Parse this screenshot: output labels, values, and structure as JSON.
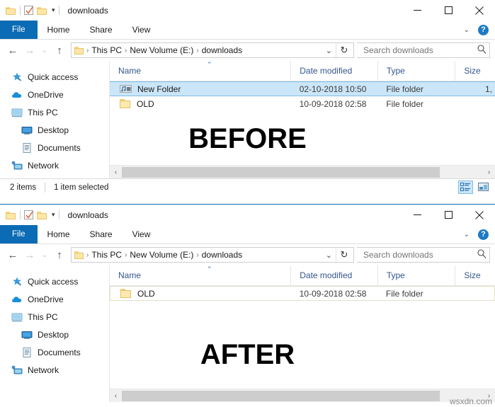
{
  "window": {
    "title": "downloads",
    "qat": {
      "folder_icon": "folder-icon",
      "properties_icon": "properties-checkbox-icon",
      "new_folder_icon": "new-folder-icon",
      "customize_caret": "▾"
    },
    "controls": {
      "minimize": "minimize-icon",
      "maximize": "maximize-icon",
      "close": "close-icon"
    },
    "ribbon": {
      "tabs": [
        "File",
        "Home",
        "Share",
        "View"
      ],
      "collapse_caret": "⌄",
      "help_label": "?"
    },
    "address": {
      "back": "←",
      "forward": "→",
      "recent": "⌄",
      "up": "↑",
      "crumbs": [
        "This PC",
        "New Volume (E:)",
        "downloads"
      ],
      "separator": "›",
      "dropdown_caret": "⌄",
      "refresh": "↻"
    },
    "search": {
      "placeholder": "Search downloads",
      "value": "",
      "icon": "search-icon"
    }
  },
  "navpane": {
    "items": [
      {
        "label": "Quick access",
        "icon": "star-pin-icon",
        "indent": false
      },
      {
        "label": "OneDrive",
        "icon": "cloud-icon",
        "indent": false
      },
      {
        "label": "This PC",
        "icon": "monitor-icon",
        "indent": false
      },
      {
        "label": "Desktop",
        "icon": "desktop-icon",
        "indent": true
      },
      {
        "label": "Documents",
        "icon": "document-icon",
        "indent": true
      },
      {
        "label": "Network",
        "icon": "network-icon",
        "indent": false
      }
    ]
  },
  "columns": {
    "name": "Name",
    "date": "Date modified",
    "type": "Type",
    "size": "Size",
    "sort_caret": "⌃"
  },
  "before": {
    "big_label": "BEFORE",
    "rows": [
      {
        "name": "New Folder",
        "date": "02-10-2018 10:50",
        "type": "File folder",
        "size": "1,",
        "icon": "music-folder-icon",
        "selected": true
      },
      {
        "name": "OLD",
        "date": "10-09-2018 02:58",
        "type": "File folder",
        "size": "",
        "icon": "folder-icon",
        "selected": false
      }
    ],
    "status": {
      "count": "2 items",
      "selection": "1 item selected"
    }
  },
  "after": {
    "big_label": "AFTER",
    "rows": [
      {
        "name": "OLD",
        "date": "10-09-2018 02:58",
        "type": "File folder",
        "size": "",
        "icon": "folder-icon",
        "selected": false
      }
    ],
    "status": {
      "count": "",
      "selection": ""
    }
  },
  "scrollbar": {
    "left_arrow": "‹",
    "right_arrow": "›"
  },
  "view_toggle": {
    "details_icon": "details-view-icon",
    "large_icons_icon": "large-icons-view-icon"
  },
  "watermark": "wsxdn.com",
  "colors": {
    "accent": "#0b6cb5",
    "selection": "#cbe6f8",
    "header_text": "#33558b"
  }
}
